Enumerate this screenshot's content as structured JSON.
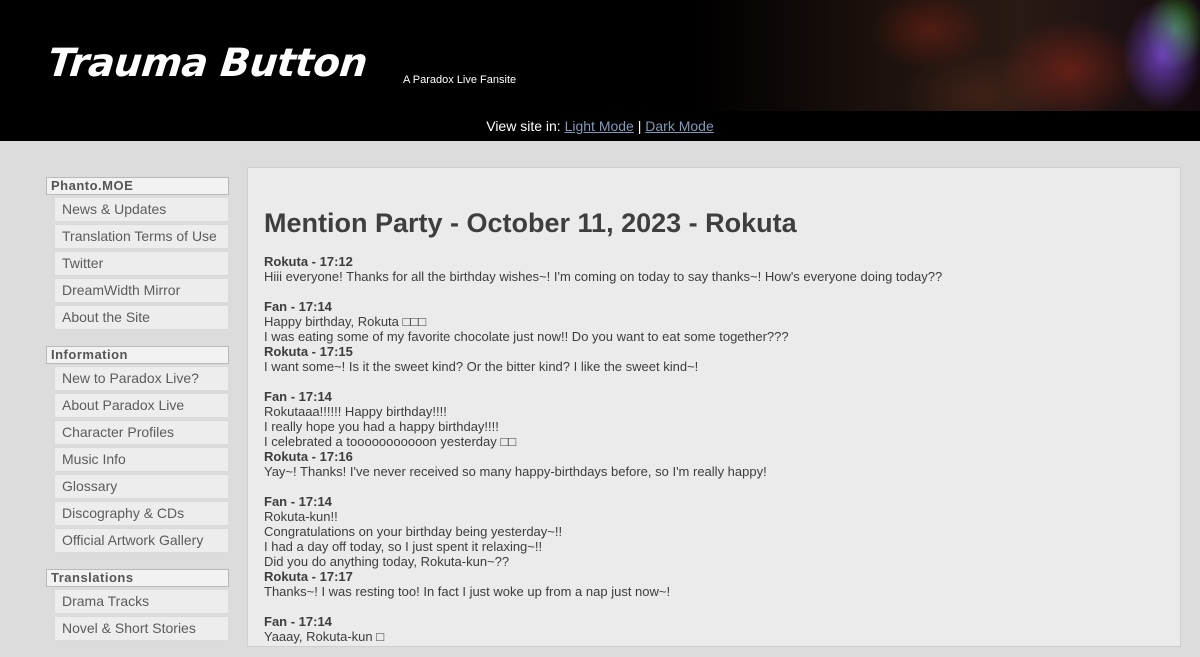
{
  "header": {
    "title": "Trauma Button",
    "tagline": "A Paradox Live Fansite"
  },
  "mode_bar": {
    "prefix": "View site in:",
    "light_label": "Light Mode",
    "separator": "|",
    "dark_label": "Dark Mode"
  },
  "sidebar": {
    "groups": [
      {
        "heading": "Phanto.MOE",
        "items": [
          "News & Updates",
          "Translation Terms of Use",
          "Twitter",
          "DreamWidth Mirror",
          "About the Site"
        ]
      },
      {
        "heading": "Information",
        "items": [
          "New to Paradox Live?",
          "About Paradox Live",
          "Character Profiles",
          "Music Info",
          "Glossary",
          "Discography & CDs",
          "Official Artwork Gallery"
        ]
      },
      {
        "heading": "Translations",
        "items": [
          "Drama Tracks",
          "Novel & Short Stories"
        ]
      }
    ]
  },
  "content": {
    "title": "Mention Party - October 11, 2023 - Rokuta",
    "blocks": [
      [
        {
          "speaker": "Rokuta - 17:12",
          "lines": [
            "Hiii everyone! Thanks for all the birthday wishes~! I'm coming on today to say thanks~! How's everyone doing today??"
          ]
        }
      ],
      [
        {
          "speaker": "Fan - 17:14",
          "lines": [
            "Happy birthday, Rokuta □□□",
            "I was eating some of my favorite chocolate just now!! Do you want to eat some together???"
          ]
        },
        {
          "speaker": "Rokuta - 17:15",
          "lines": [
            "I want some~! Is it the sweet kind? Or the bitter kind? I like the sweet kind~!"
          ]
        }
      ],
      [
        {
          "speaker": "Fan - 17:14",
          "lines": [
            "Rokutaaa!!!!!! Happy birthday!!!!",
            "I really hope you had a happy birthday!!!!",
            "I celebrated a tooooooooooon yesterday □□"
          ]
        },
        {
          "speaker": "Rokuta - 17:16",
          "lines": [
            "Yay~! Thanks! I've never received so many happy-birthdays before, so I'm really happy!"
          ]
        }
      ],
      [
        {
          "speaker": "Fan - 17:14",
          "lines": [
            "Rokuta-kun!!",
            "Congratulations on your birthday being yesterday~!!",
            "I had a day off today, so I just spent it relaxing~!!",
            "Did you do anything today, Rokuta-kun~??"
          ]
        },
        {
          "speaker": "Rokuta - 17:17",
          "lines": [
            "Thanks~! I was resting too! In fact I just woke up from a nap just now~!"
          ]
        }
      ],
      [
        {
          "speaker": "Fan - 17:14",
          "lines": [
            "Yaaay, Rokuta-kun □"
          ]
        }
      ]
    ]
  }
}
